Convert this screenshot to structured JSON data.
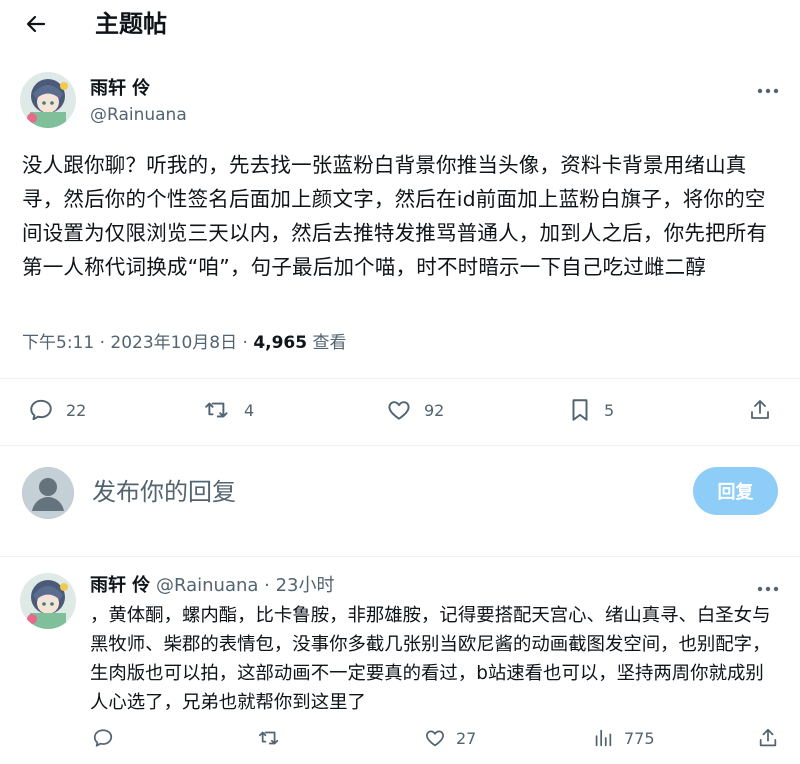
{
  "header": {
    "title": "主题帖",
    "back_icon": "arrow-left-icon"
  },
  "main_tweet": {
    "author_name": "雨轩 伶",
    "handle": "@Rainuana",
    "text": "没人跟你聊？听我的，先去找一张蓝粉白背景你推当头像，资料卡背景用绪山真寻，然后你的个性签名后面加上颜文字，然后在id前面加上蓝粉白旗子，将你的空间设置为仅限浏览三天以内，然后去推特发推骂普通人，加到人之后，你先把所有第一人称代词换成“咱”，句子最后加个喵，时不时暗示一下自己吃过雌二醇",
    "time": "下午5:11 · 2023年10月8日 · ",
    "views_count": "4,965",
    "views_label": " 查看",
    "stats": {
      "replies": "22",
      "retweets": "4",
      "likes": "92",
      "bookmarks": "5"
    }
  },
  "reply_box": {
    "placeholder": "发布你的回复",
    "button_label": "回复"
  },
  "reply_tweet": {
    "author_name": "雨轩 伶",
    "handle_time": " @Rainuana · 23小时",
    "text": "，黄体酮，螺内酯，比卡鲁胺，非那雄胺，记得要搭配天宫心、绪山真寻、白圣女与黑牧师、柴郡的表情包，没事你多截几张别当欧尼酱的动画截图发空间，也别配字，生肉版也可以拍，这部动画不一定要真的看过，b站速看也可以，坚持两周你就成别人心选了，兄弟也就帮你到这里了",
    "stats": {
      "likes": "27",
      "views": "775"
    }
  },
  "colors": {
    "text": "#0f1419",
    "secondary": "#536471",
    "reply_button": "#8ecdf8",
    "divider": "#eff3f4"
  }
}
